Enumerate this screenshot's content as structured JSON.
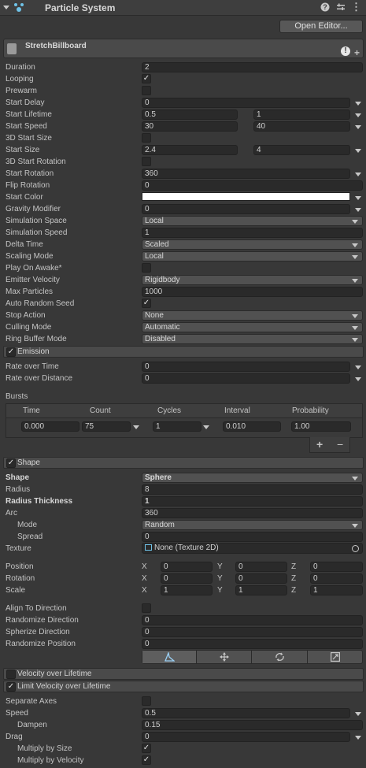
{
  "header": {
    "title": "Particle System"
  },
  "open_editor": "Open Editor...",
  "system_name": "StretchBillboard",
  "main_rows": [
    {
      "label": "Duration",
      "value": "2"
    },
    {
      "label": "Looping",
      "value": "✓"
    },
    {
      "label": "Prewarm",
      "value": ""
    },
    {
      "label": "Start Delay",
      "value": "0"
    },
    {
      "label": "Start Lifetime",
      "value": "0.5",
      "value2": "1"
    },
    {
      "label": "Start Speed",
      "value": "30",
      "value2": "40"
    },
    {
      "label": "3D Start Size",
      "value": ""
    },
    {
      "label": "Start Size",
      "value": "2.4",
      "value2": "4"
    },
    {
      "label": "3D Start Rotation",
      "value": ""
    },
    {
      "label": "Start Rotation",
      "value": "360"
    },
    {
      "label": "Flip Rotation",
      "value": "0"
    },
    {
      "label": "Start Color",
      "value": ""
    },
    {
      "label": "Gravity Modifier",
      "value": "0"
    },
    {
      "label": "Simulation Space",
      "value": "Local"
    },
    {
      "label": "Simulation Speed",
      "value": "1"
    },
    {
      "label": "Delta Time",
      "value": "Scaled"
    },
    {
      "label": "Scaling Mode",
      "value": "Local"
    },
    {
      "label": "Play On Awake*",
      "value": ""
    },
    {
      "label": "Emitter Velocity",
      "value": "Rigidbody"
    },
    {
      "label": "Max Particles",
      "value": "1000"
    },
    {
      "label": "Auto Random Seed",
      "value": "✓"
    },
    {
      "label": "Stop Action",
      "value": "None"
    },
    {
      "label": "Culling Mode",
      "value": "Automatic"
    },
    {
      "label": "Ring Buffer Mode",
      "value": "Disabled"
    }
  ],
  "emission": {
    "title": "Emission",
    "rate_time_label": "Rate over Time",
    "rate_time": "0",
    "rate_dist_label": "Rate over Distance",
    "rate_dist": "0",
    "bursts_label": "Bursts",
    "burst_headers": [
      "Time",
      "Count",
      "Cycles",
      "Interval",
      "Probability"
    ],
    "burst": {
      "time": "0.000",
      "count": "75",
      "cycles": "1",
      "interval": "0.010",
      "probability": "1.00"
    },
    "plus": "+",
    "minus": "−"
  },
  "shape": {
    "title": "Shape",
    "shape_label": "Shape",
    "shape_value": "Sphere",
    "radius_label": "Radius",
    "radius": "8",
    "thickness_label": "Radius Thickness",
    "thickness": "1",
    "arc_label": "Arc",
    "arc": "360",
    "mode_label": "Mode",
    "mode": "Random",
    "spread_label": "Spread",
    "spread": "0",
    "texture_label": "Texture",
    "texture": "None (Texture 2D)",
    "position_label": "Position",
    "rotation_label": "Rotation",
    "scale_label": "Scale",
    "x": "X",
    "y": "Y",
    "z": "Z",
    "position": [
      "0",
      "0",
      "0"
    ],
    "rotation": [
      "0",
      "0",
      "0"
    ],
    "scale": [
      "1",
      "1",
      "1"
    ],
    "align_label": "Align To Direction",
    "rand_dir_label": "Randomize Direction",
    "rand_dir": "0",
    "spherize_label": "Spherize Direction",
    "spherize": "0",
    "rand_pos_label": "Randomize Position",
    "rand_pos": "0"
  },
  "velocity_title": "Velocity over Lifetime",
  "limit": {
    "title": "Limit Velocity over Lifetime",
    "separate_label": "Separate Axes",
    "speed_label": "Speed",
    "speed": "0.5",
    "dampen_label": "Dampen",
    "dampen": "0.15",
    "drag_label": "Drag",
    "drag": "0",
    "mult_size_label": "Multiply by Size",
    "mult_vel_label": "Multiply by Velocity",
    "check": "✓"
  }
}
